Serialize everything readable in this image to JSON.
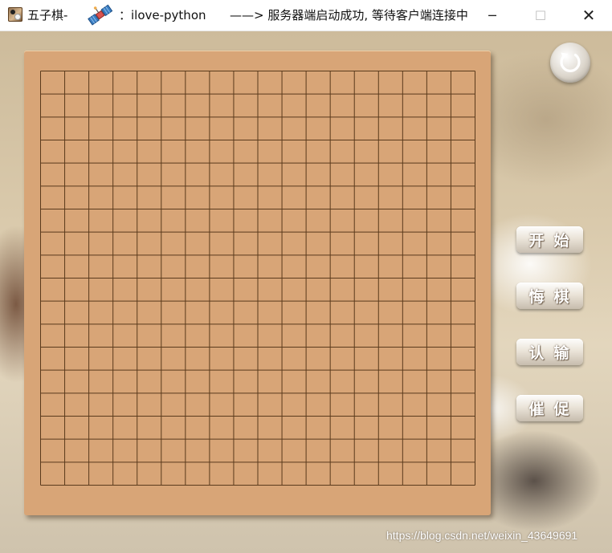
{
  "window": {
    "title_prefix": "五子棋-",
    "title_user": "：ilove-python",
    "title_status": "——> 服务器端启动成功, 等待客户端连接中",
    "minimize_label": "─",
    "maximize_label": "☐",
    "close_label": "✕"
  },
  "board": {
    "lines": 19,
    "line_color": "#5a3a1c",
    "board_color": "#d8a577"
  },
  "buttons": {
    "start": "开始",
    "undo": "悔棋",
    "resign": "认输",
    "urge": "催促"
  },
  "icons": {
    "refresh": "refresh-icon",
    "app": "gomoku-app-icon",
    "satellite": "satellite-icon"
  },
  "watermark": "https://blog.csdn.net/weixin_43649691"
}
